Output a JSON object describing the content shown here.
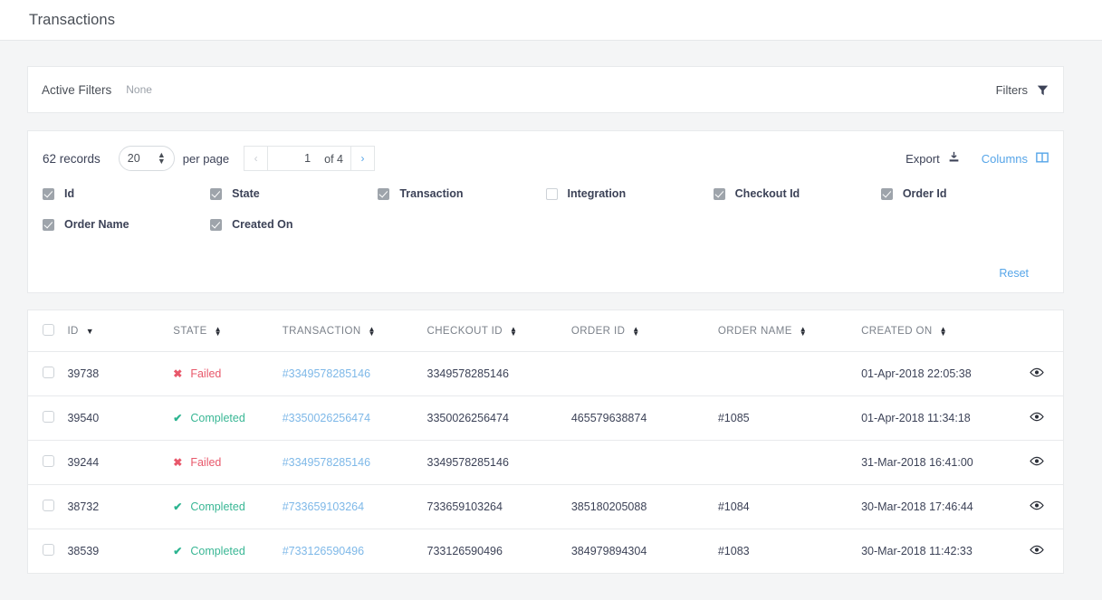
{
  "header": {
    "title": "Transactions"
  },
  "active_filters": {
    "label": "Active Filters",
    "value": "None",
    "filters_button": "Filters",
    "filters_icon": "funnel-icon"
  },
  "toolbar": {
    "records": "62 records",
    "per_page_value": "20",
    "per_page_options": [
      "20"
    ],
    "per_page_label": "per page",
    "prev_label": "‹",
    "page_value": "1",
    "of_label": "of 4",
    "next_label": "›",
    "export_label": "Export",
    "export_icon": "download-icon",
    "columns_label": "Columns",
    "columns_icon": "columns-icon"
  },
  "columns_panel": {
    "items": [
      {
        "label": "Id",
        "checked": true
      },
      {
        "label": "State",
        "checked": true
      },
      {
        "label": "Transaction",
        "checked": true
      },
      {
        "label": "Integration",
        "checked": false
      },
      {
        "label": "Checkout Id",
        "checked": true
      },
      {
        "label": "Order Id",
        "checked": true
      },
      {
        "label": "Order Name",
        "checked": true
      },
      {
        "label": "Created On",
        "checked": true
      }
    ],
    "reset_label": "Reset"
  },
  "table": {
    "headers": [
      {
        "label": "ID",
        "sort": "desc"
      },
      {
        "label": "STATE",
        "sort": "none"
      },
      {
        "label": "TRANSACTION",
        "sort": "none"
      },
      {
        "label": "CHECKOUT ID",
        "sort": "none"
      },
      {
        "label": "ORDER ID",
        "sort": "none"
      },
      {
        "label": "ORDER NAME",
        "sort": "none"
      },
      {
        "label": "CREATED ON",
        "sort": "none"
      }
    ],
    "rows": [
      {
        "id": "39738",
        "state": "Failed",
        "state_kind": "failed",
        "transaction": "#3349578285146",
        "checkout_id": "3349578285146",
        "order_id": "",
        "order_name": "",
        "created_on": "01-Apr-2018 22:05:38"
      },
      {
        "id": "39540",
        "state": "Completed",
        "state_kind": "completed",
        "transaction": "#3350026256474",
        "checkout_id": "3350026256474",
        "order_id": "465579638874",
        "order_name": "#1085",
        "created_on": "01-Apr-2018 11:34:18"
      },
      {
        "id": "39244",
        "state": "Failed",
        "state_kind": "failed",
        "transaction": "#3349578285146",
        "checkout_id": "3349578285146",
        "order_id": "",
        "order_name": "",
        "created_on": "31-Mar-2018 16:41:00"
      },
      {
        "id": "38732",
        "state": "Completed",
        "state_kind": "completed",
        "transaction": "#733659103264",
        "checkout_id": "733659103264",
        "order_id": "385180205088",
        "order_name": "#1084",
        "created_on": "30-Mar-2018 17:46:44"
      },
      {
        "id": "38539",
        "state": "Completed",
        "state_kind": "completed",
        "transaction": "#733126590496",
        "checkout_id": "733126590496",
        "order_id": "384979894304",
        "order_name": "#1083",
        "created_on": "30-Mar-2018 11:42:33"
      }
    ],
    "view_icon": "eye-icon"
  },
  "colors": {
    "link": "#56a5e8",
    "failed": "#e8586b",
    "completed": "#3ab795",
    "page_bg": "#f4f5f6"
  }
}
